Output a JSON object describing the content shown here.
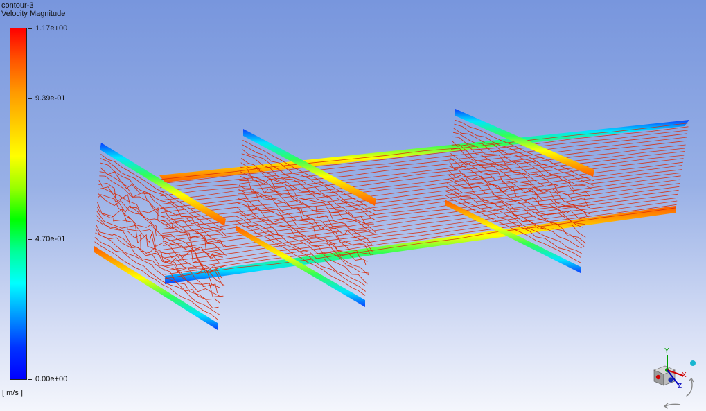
{
  "header": {
    "title": "contour-3",
    "quantity": "Velocity Magnitude"
  },
  "legend": {
    "max": "1.17e+00",
    "upper_mid": "9.39e-01",
    "lower_mid": "4.70e-01",
    "min": "0.00e+00",
    "unit": "[ m/s ]",
    "colors": [
      "#ff0000",
      "#ff5500",
      "#ff9900",
      "#ffcc00",
      "#ffff00",
      "#99ff00",
      "#00ff00",
      "#00ff99",
      "#00ffff",
      "#0099ff",
      "#0033ff",
      "#0000ff"
    ]
  },
  "axes": {
    "x": "X",
    "y": "Y",
    "z": "Z"
  }
}
